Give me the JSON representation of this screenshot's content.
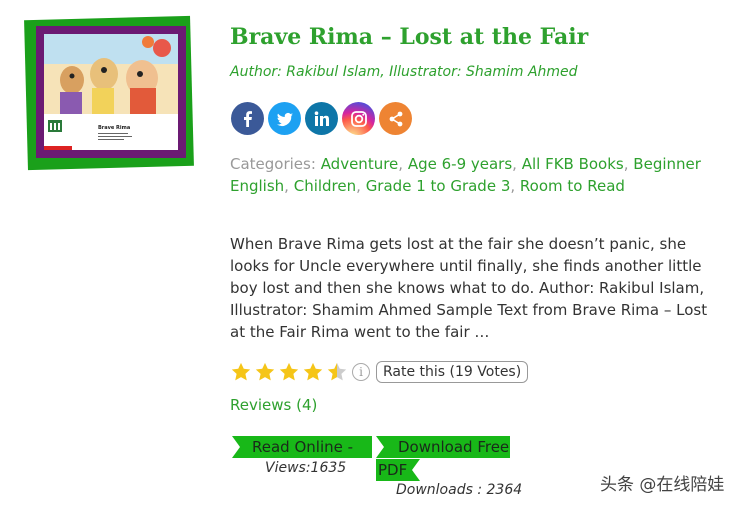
{
  "book": {
    "title": "Brave Rima – Lost at the Fair",
    "author_line": "Author: Rakibul Islam, Illustrator: Shamim Ahmed",
    "cover": {
      "title": "Brave Rima",
      "frame_color": "#1aa01a",
      "border_color": "#6b1a73"
    }
  },
  "social": {
    "buttons": [
      {
        "name": "facebook-icon",
        "color": "#3b5998"
      },
      {
        "name": "twitter-icon",
        "color": "#1da1f2"
      },
      {
        "name": "linkedin-icon",
        "color": "#0e76a8"
      },
      {
        "name": "instagram-icon",
        "color": "#d6249f"
      },
      {
        "name": "share-icon",
        "color": "#ee8433"
      }
    ]
  },
  "categories": {
    "label": "Categories:",
    "items": [
      "Adventure",
      "Age 6-9 years",
      "All FKB Books",
      "Beginner English",
      "Children",
      "Grade 1 to Grade 3",
      "Room to Read"
    ]
  },
  "description": "When Brave Rima gets lost at the fair she doesn’t panic, she looks for Uncle everywhere until finally, she finds another little boy lost and then she knows what to do. Author: Rakibul Islam, Illustrator: Shamim Ahmed       Sample Text from Brave Rima – Lost at the Fair Rima went to the fair …",
  "rating": {
    "stars_filled": 4.5,
    "stars_total": 5,
    "info_glyph": "i",
    "rate_label": "Rate this (19 Votes)"
  },
  "reviews": {
    "label": "Reviews (4)"
  },
  "actions": {
    "read_online": "Read Online -",
    "views": "Views:1635",
    "download_line1": "Download Free",
    "download_line2": "PDF -",
    "downloads": "Downloads : 2364"
  },
  "colors": {
    "accent_green": "#2ea12e",
    "button_green": "#18b818",
    "star_yellow": "#f5c518"
  },
  "watermark": "头条 @在线陪娃"
}
